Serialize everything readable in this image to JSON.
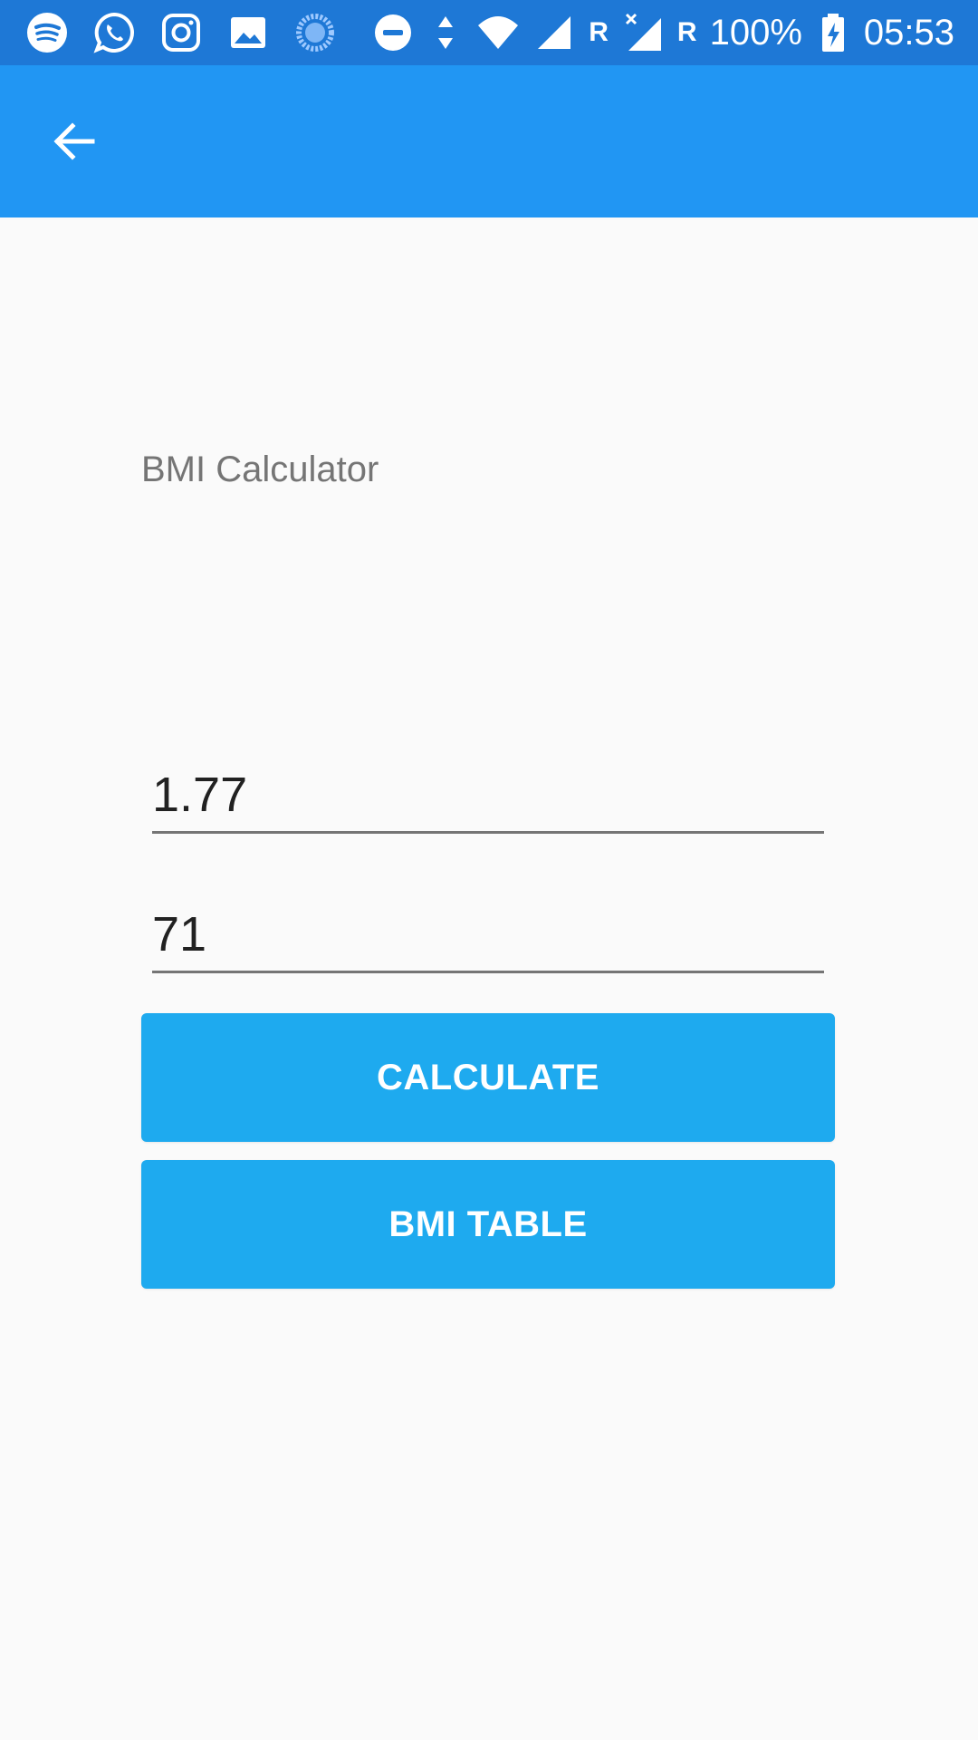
{
  "status_bar": {
    "battery": "100%",
    "time": "05:53",
    "roaming_1": "R",
    "roaming_2": "R",
    "left_icons": [
      "spotify-icon",
      "whatsapp-icon",
      "instagram-icon",
      "gallery-icon",
      "sync-icon"
    ],
    "right_icons": [
      "dnd-icon",
      "data-arrows-icon",
      "wifi-icon",
      "signal-icon",
      "signal-no-data-icon",
      "battery-charging-icon"
    ]
  },
  "app_bar": {
    "back_icon": "arrow-back-icon",
    "color": "#2196f3"
  },
  "form": {
    "title": "BMI Calculator",
    "height_value": "1.77",
    "weight_value": "71"
  },
  "buttons": {
    "calculate_label": "CALCULATE",
    "table_label": "BMI TABLE",
    "color": "#1eaaef"
  }
}
